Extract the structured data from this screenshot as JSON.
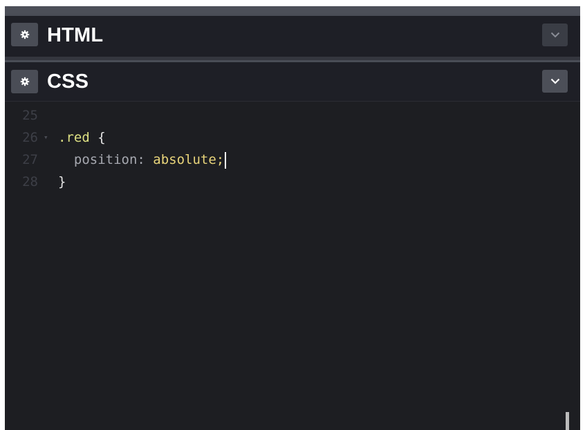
{
  "panels": [
    {
      "title": "HTML",
      "settings_icon": "gear-icon",
      "toggle_icon": "chevron-down-icon"
    },
    {
      "title": "CSS",
      "settings_icon": "gear-icon",
      "toggle_icon": "chevron-down-icon"
    }
  ],
  "editor": {
    "lines": [
      {
        "number": "25",
        "has_fold": false,
        "tokens": []
      },
      {
        "number": "26",
        "has_fold": true,
        "fold_glyph": "▾",
        "tokens": [
          {
            "type": "sel",
            "text": ".red"
          },
          {
            "type": "brace",
            "text": " {"
          }
        ]
      },
      {
        "number": "27",
        "has_fold": false,
        "tokens": [
          {
            "type": "prop",
            "text": "  position: "
          },
          {
            "type": "val",
            "text": "absolute;"
          }
        ],
        "caret": true
      },
      {
        "number": "28",
        "has_fold": false,
        "tokens": [
          {
            "type": "brace",
            "text": "}"
          }
        ]
      }
    ]
  },
  "colors": {
    "selector": "#dde083",
    "property": "#a6a8b0",
    "value": "#e8d47a",
    "editor_bg": "#1d1e22"
  }
}
